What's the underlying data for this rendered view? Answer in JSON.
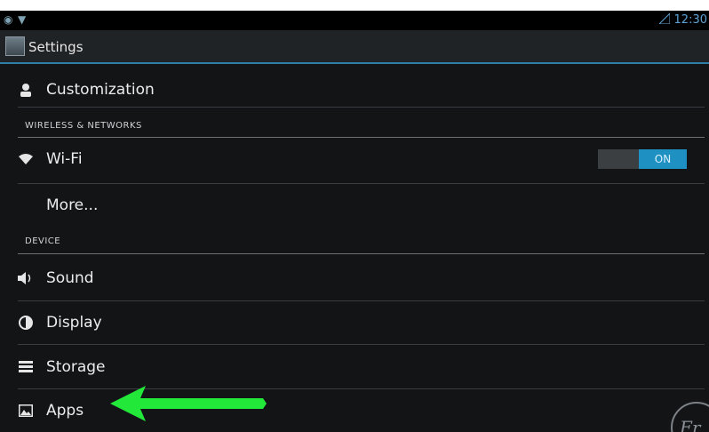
{
  "status_bar": {
    "clock": "12:30",
    "left_icons": [
      "gps-icon",
      "wifi-icon"
    ]
  },
  "action_bar": {
    "title": "Settings"
  },
  "sections": {
    "wireless_header": "WIRELESS & NETWORKS",
    "device_header": "DEVICE"
  },
  "items": {
    "customization": "Customization",
    "wifi": "Wi-Fi",
    "wifi_toggle": "ON",
    "more": "More...",
    "sound": "Sound",
    "display": "Display",
    "storage": "Storage",
    "apps": "Apps"
  },
  "colors": {
    "accent": "#1f90c2",
    "arrow": "#22e83a",
    "background": "#121416"
  },
  "watermark_logo": "Fr"
}
